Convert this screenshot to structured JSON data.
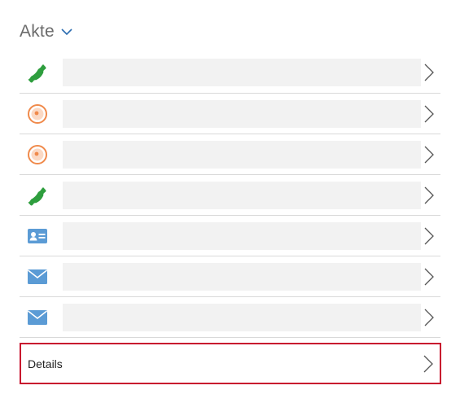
{
  "header": {
    "title": "Akte",
    "chevron_icon": "chevron-down-icon",
    "accent_color": "#2b6cb0"
  },
  "items": [
    {
      "type": "phone",
      "icon": "phone-icon",
      "icon_color": "#2e9e3e"
    },
    {
      "type": "target",
      "icon": "target-icon",
      "icon_color": "#f08a4b"
    },
    {
      "type": "target",
      "icon": "target-icon",
      "icon_color": "#f08a4b"
    },
    {
      "type": "phone",
      "icon": "phone-icon",
      "icon_color": "#2e9e3e"
    },
    {
      "type": "contact",
      "icon": "contact-card-icon",
      "icon_color": "#5b9bd5"
    },
    {
      "type": "mail",
      "icon": "mail-icon",
      "icon_color": "#5b9bd5"
    },
    {
      "type": "mail",
      "icon": "mail-icon",
      "icon_color": "#5b9bd5"
    }
  ],
  "details": {
    "label": "Details",
    "highlight_color": "#c8102e"
  }
}
